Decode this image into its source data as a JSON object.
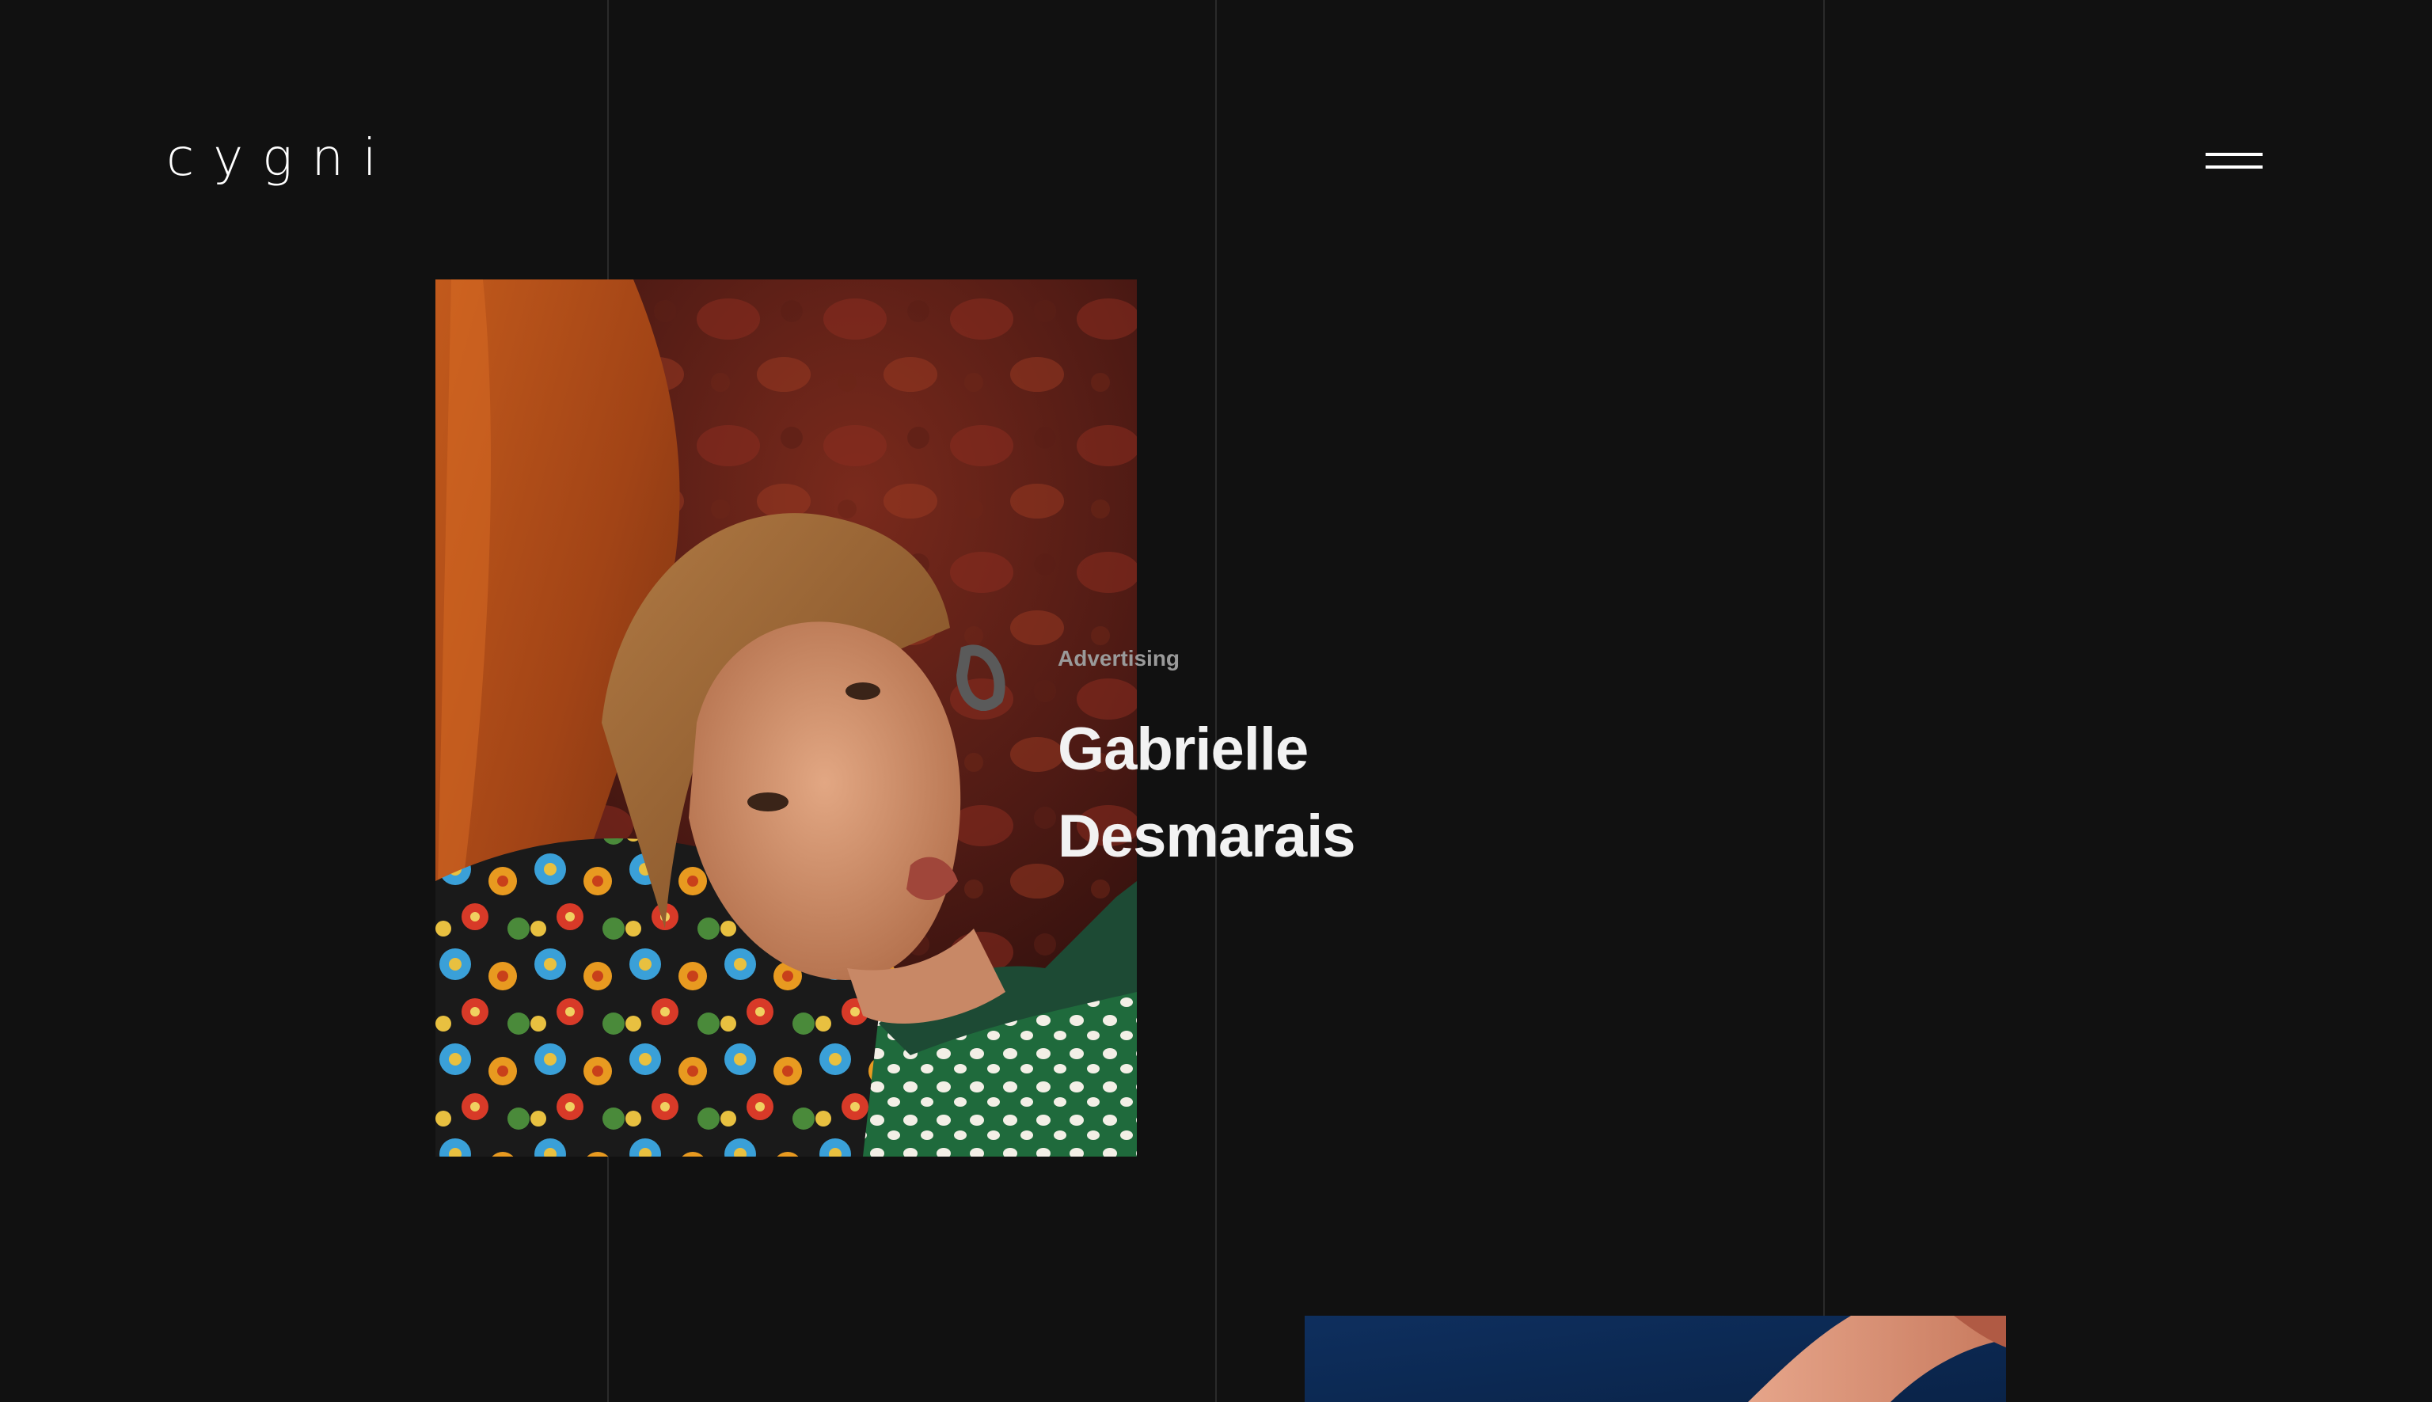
{
  "brand": {
    "logo_text": "cygni"
  },
  "header": {
    "menu_icon": "hamburger-icon"
  },
  "featured_project": {
    "category": "Advertising",
    "title_line1": "Gabrielle",
    "title_line2": "Desmarais"
  },
  "colors": {
    "background": "#111111",
    "grid_line": "#2a2a2a",
    "title_text": "#f2f2f2",
    "category_text": "#9a9a9a"
  }
}
